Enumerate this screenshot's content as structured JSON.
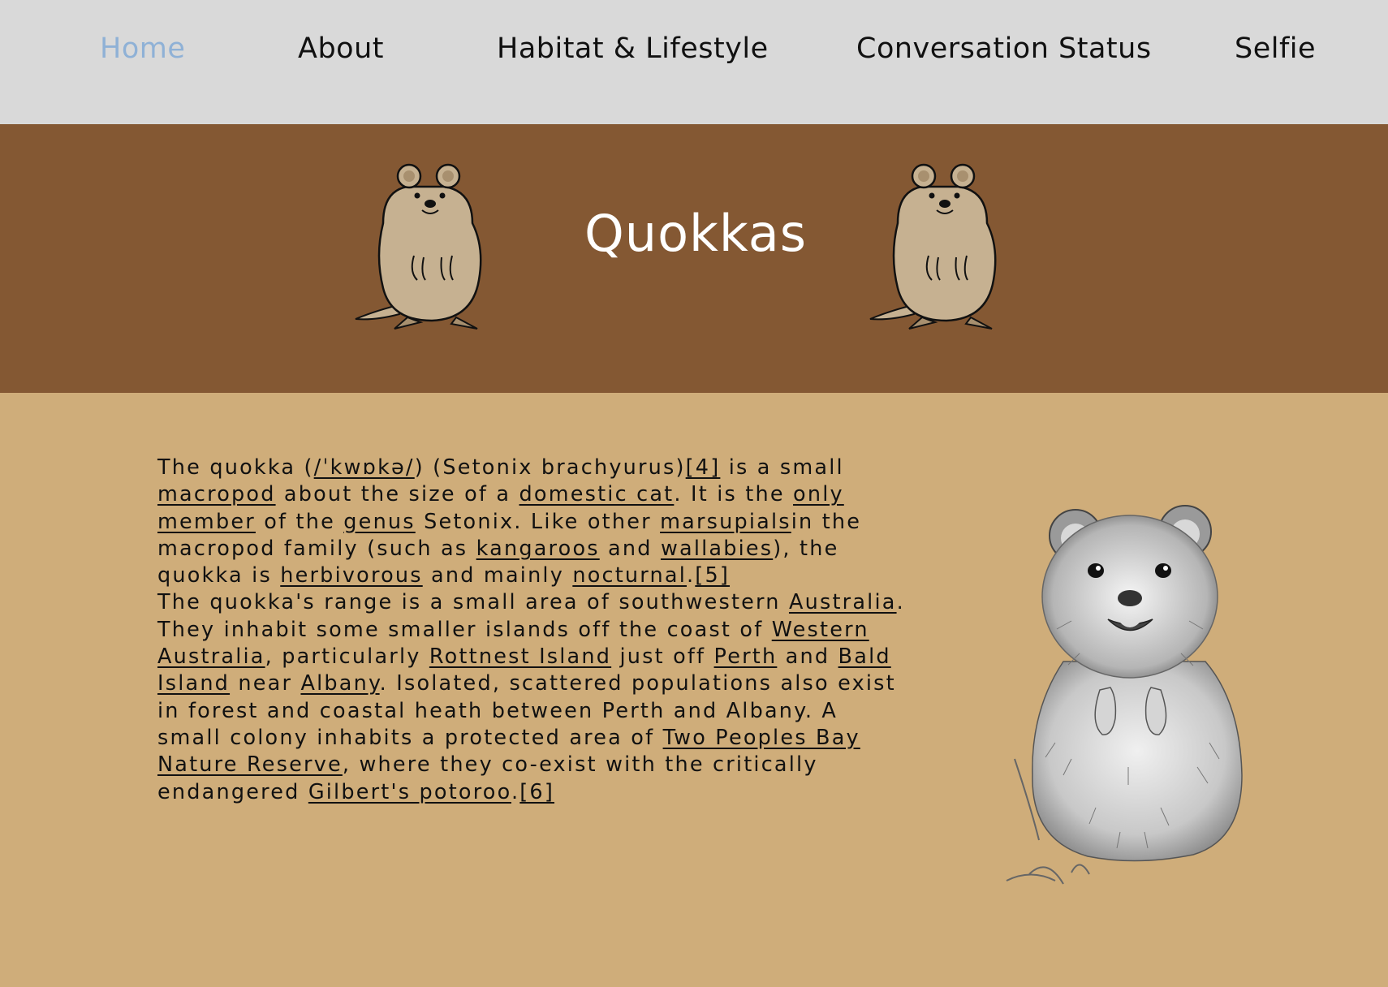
{
  "nav": {
    "items": [
      {
        "label": "Home",
        "active": true
      },
      {
        "label": "About"
      },
      {
        "label": "Habitat & Lifestyle"
      },
      {
        "label": "Conversation Status"
      },
      {
        "label": "Selfie"
      }
    ]
  },
  "hero": {
    "title": "Quokkas",
    "illustration": "cartoon-quokka-icon"
  },
  "article": {
    "p1": {
      "t0": "The quokka (",
      "l_ipa": "/ˈkwɒkə/",
      "t1": ") (Setonix brachyurus)",
      "l_ref4": "[4]",
      "t2": " is a small ",
      "l_macropod": "macropod",
      "t3": " about the size of a ",
      "l_cat": "domestic cat",
      "t4": ". It is the ",
      "l_only": "only member",
      "t5": " of the ",
      "l_genus": "genus",
      "t6": " Setonix. Like other ",
      "l_marsupials": "marsupials",
      "t7": "in the macropod family (such as ",
      "l_kangaroos": "kangaroos",
      "t8": " and ",
      "l_wallabies": "wallabies",
      "t9": "), the quokka is ",
      "l_herbivorous": "herbivorous",
      "t10": " and mainly ",
      "l_nocturnal": "nocturnal",
      "t11": ".",
      "l_ref5": "[5]"
    },
    "p2": {
      "t0": "The quokka's range is a small area of southwestern ",
      "l_australia": "Australia",
      "t1": ". They inhabit some smaller islands off the coast of ",
      "l_wa": "Western Australia",
      "t2": ", particularly ",
      "l_rottnest": "Rottnest Island",
      "t3": " just off ",
      "l_perth": "Perth",
      "t4": " and ",
      "l_bald": "Bald Island",
      "t5": " near ",
      "l_albany": "Albany",
      "t6": ". Isolated, scattered populations also exist in forest and coastal heath between Perth and Albany. A small colony inhabits a protected area of ",
      "l_twopeoples": "Two Peoples Bay Nature Reserve",
      "t7": ", where they co-exist with the critically endangered ",
      "l_potoroo": "Gilbert's potoroo",
      "t8": ".",
      "l_ref6": "[6]"
    }
  },
  "photo": {
    "illustration": "quokka-sketch-image"
  },
  "colors": {
    "nav_bg": "#d9d9d9",
    "nav_active": "#8fb1d6",
    "hero_bg": "#845833",
    "page_bg": "#cfad7a",
    "quokka_fur": "#c6b191"
  }
}
